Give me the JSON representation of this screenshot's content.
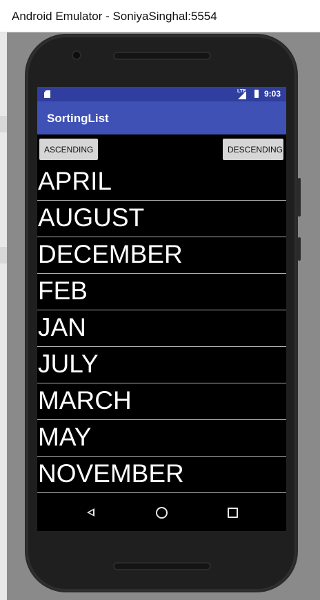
{
  "window": {
    "title": "Android Emulator - SoniyaSinghal:5554"
  },
  "statusbar": {
    "time": "9:03",
    "network": "LTE"
  },
  "app": {
    "title": "SortingList"
  },
  "buttons": {
    "ascending": "ASCENDING",
    "descending": "DESCENDING"
  },
  "months": [
    "APRIL",
    "AUGUST",
    "DECEMBER",
    "FEB",
    "JAN",
    "JULY",
    "MARCH",
    "MAY",
    "NOVEMBER"
  ],
  "colors": {
    "appbar": "#3f51b5",
    "statusbar": "#303f9f",
    "list_bg": "#000000"
  }
}
